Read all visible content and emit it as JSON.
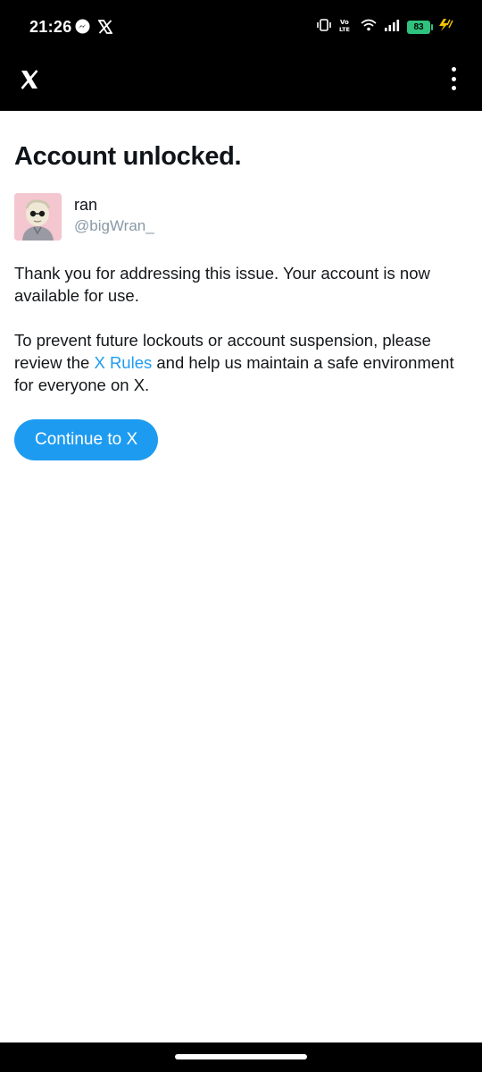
{
  "status_bar": {
    "time": "21:26",
    "battery_level": "83",
    "left_icons": [
      "messenger-icon",
      "x-icon"
    ],
    "right_icons": [
      "vibrate-icon",
      "volte-icon",
      "wifi-icon",
      "signal-icon",
      "battery-icon",
      "charging-icon"
    ]
  },
  "app_bar": {
    "logo": "x-logo-icon",
    "menu": "more-options-icon"
  },
  "main": {
    "title": "Account unlocked.",
    "user": {
      "display_name": "ran",
      "handle": "@bigWran_"
    },
    "paragraph1": "Thank you for addressing this issue. Your account is now available for use.",
    "paragraph2_before": "To prevent future lockouts or account suspension, please review the ",
    "paragraph2_link": "X Rules",
    "paragraph2_after": " and help us maintain a safe environment for everyone on X.",
    "cta_label": "Continue to X"
  },
  "colors": {
    "accent": "#1d9bf0",
    "title_text": "#0f1419",
    "handle_text": "#8899a6",
    "battery": "#2ec27e",
    "bar_background": "#000000"
  }
}
